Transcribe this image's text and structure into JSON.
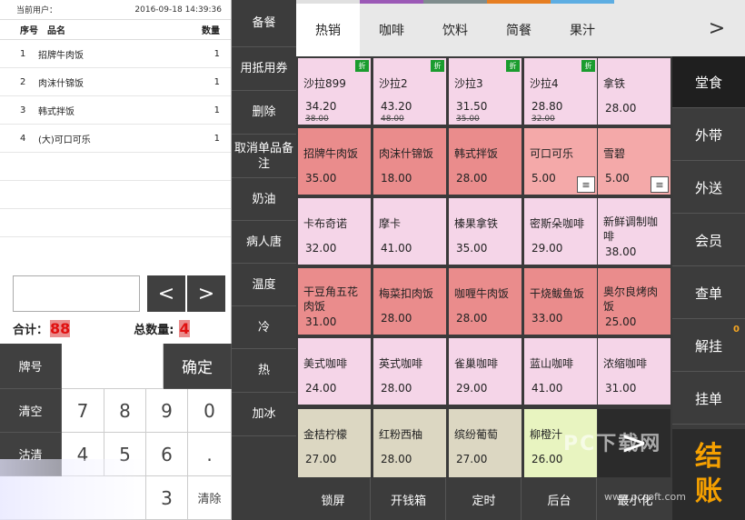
{
  "order": {
    "user_label": "当前用户：",
    "datetime": "2016-09-18 14:39:36",
    "col_no": "序号",
    "col_name": "品名",
    "col_qty": "数量",
    "items": [
      {
        "no": "1",
        "name": "招牌牛肉饭",
        "qty": "1"
      },
      {
        "no": "2",
        "name": "肉沫什锦饭",
        "qty": "1"
      },
      {
        "no": "3",
        "name": "韩式拌饭",
        "qty": "1"
      },
      {
        "no": "4",
        "name": "(大)可口可乐",
        "qty": "1"
      }
    ],
    "total_label": "合计：",
    "total_value": "88",
    "count_label": "总数量:",
    "count_value": "4",
    "prev": "<",
    "next": ">"
  },
  "keypad": {
    "tag": "牌号",
    "confirm": "确定",
    "clear_all": "清空",
    "clear_item": "沽清",
    "delete": "清除",
    "k7": "7",
    "k8": "8",
    "k9": "9",
    "k0": "0",
    "k4": "4",
    "k5": "5",
    "k6": "6",
    "kdot": ".",
    "k3": "3"
  },
  "mid_actions": [
    "备餐",
    "用抵用券",
    "删除",
    "取消单品备注",
    "奶油",
    "病人唐",
    "温度",
    "冷",
    "热",
    "加冰"
  ],
  "tabs": [
    "热销",
    "咖啡",
    "饮料",
    "简餐",
    "果汁"
  ],
  "tab_colors": [
    "#e0e0e0",
    "#9b59b6",
    "#7f8c8d",
    "#e67e22",
    "#5dade2"
  ],
  "tab_next": ">",
  "discount_badge": "折",
  "menu_icon": "≡",
  "products": [
    {
      "name": "沙拉899",
      "price": "34.20",
      "old": "38.00",
      "disc": true,
      "color": "pink"
    },
    {
      "name": "沙拉2",
      "price": "43.20",
      "old": "48.00",
      "disc": true,
      "color": "pink"
    },
    {
      "name": "沙拉3",
      "price": "31.50",
      "old": "35.00",
      "disc": true,
      "color": "pink"
    },
    {
      "name": "沙拉4",
      "price": "28.80",
      "old": "32.00",
      "disc": true,
      "color": "pink"
    },
    {
      "name": "拿铁",
      "price": "28.00",
      "color": "pink"
    },
    {
      "name": "招牌牛肉饭",
      "price": "35.00",
      "color": "red"
    },
    {
      "name": "肉沫什锦饭",
      "price": "18.00",
      "color": "red"
    },
    {
      "name": "韩式拌饭",
      "price": "28.00",
      "color": "red"
    },
    {
      "name": "可口可乐",
      "price": "5.00",
      "menu": true,
      "color": "salmon"
    },
    {
      "name": "雪碧",
      "price": "5.00",
      "menu": true,
      "color": "salmon"
    },
    {
      "name": "卡布奇诺",
      "price": "32.00",
      "color": "pink"
    },
    {
      "name": "摩卡",
      "price": "41.00",
      "color": "pink"
    },
    {
      "name": "榛果拿铁",
      "price": "35.00",
      "color": "pink"
    },
    {
      "name": "密斯朵咖啡",
      "price": "29.00",
      "color": "pink"
    },
    {
      "name": "新鲜调制咖啡",
      "price": "38.00",
      "color": "pink",
      "two": true
    },
    {
      "name": "干豆角五花肉饭",
      "price": "31.00",
      "color": "red",
      "two": true
    },
    {
      "name": "梅菜扣肉饭",
      "price": "28.00",
      "color": "red"
    },
    {
      "name": "咖喱牛肉饭",
      "price": "28.00",
      "color": "red"
    },
    {
      "name": "干烧鲅鱼饭",
      "price": "33.00",
      "color": "red"
    },
    {
      "name": "奥尔良烤肉饭",
      "price": "25.00",
      "color": "red",
      "two": true
    },
    {
      "name": "美式咖啡",
      "price": "24.00",
      "color": "pink"
    },
    {
      "name": "英式咖啡",
      "price": "28.00",
      "color": "pink"
    },
    {
      "name": "雀巢咖啡",
      "price": "29.00",
      "color": "pink"
    },
    {
      "name": "蓝山咖啡",
      "price": "41.00",
      "color": "pink"
    },
    {
      "name": "浓缩咖啡",
      "price": "31.00",
      "color": "pink"
    },
    {
      "name": "金桔柠檬",
      "price": "27.00",
      "color": "beige"
    },
    {
      "name": "红粉西柚",
      "price": "28.00",
      "color": "beige"
    },
    {
      "name": "缤纷葡萄",
      "price": "27.00",
      "color": "beige"
    },
    {
      "name": "柳橙汁",
      "price": "26.00",
      "color": "lime"
    }
  ],
  "grid_next": ">",
  "dine_modes": [
    "堂食",
    "外带",
    "外送",
    "会员",
    "查单",
    "解挂",
    "挂单"
  ],
  "hang_count": "0",
  "checkout": [
    "结",
    "账"
  ],
  "bottom_actions": [
    "锁屏",
    "开钱箱",
    "定时",
    "后台",
    "最小化"
  ],
  "watermark": "PC下载网",
  "watermark_url": "www.pcsoft.com"
}
